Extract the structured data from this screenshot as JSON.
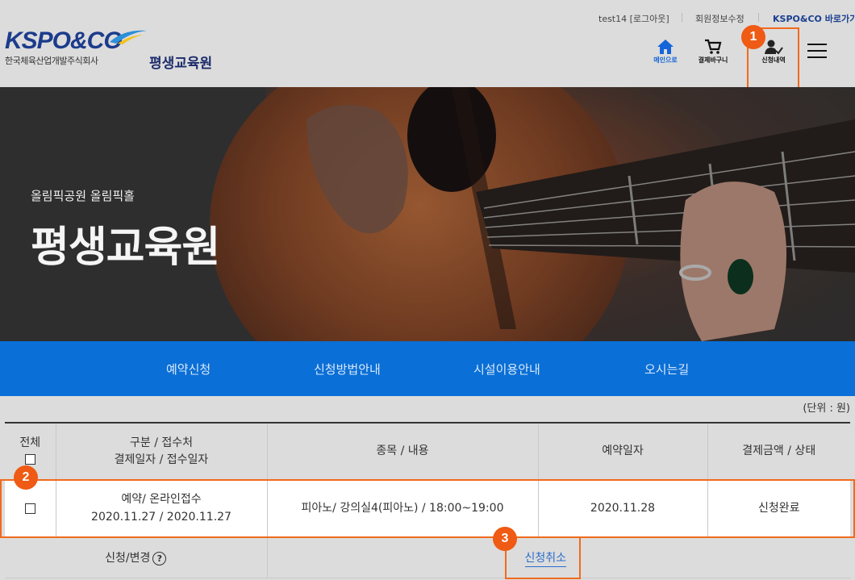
{
  "topbar": {
    "user": "test14 [로그아웃]",
    "edit_profile": "회원정보수정",
    "shortcut": "KSPO&CO 바로가기"
  },
  "logo": {
    "brand": "KSPO&CO",
    "subtitle": "한국체육산업개발주식회사"
  },
  "site_title": "평생교육원",
  "header_icons": {
    "home": "메인으로",
    "cart": "결제바구니",
    "history": "신청내역"
  },
  "badges": [
    "1",
    "2",
    "3"
  ],
  "banner": {
    "subtitle": "올림픽공원 올림픽홀",
    "title": "평생교육원"
  },
  "menu": [
    "예약신청",
    "신청방법안내",
    "시설이용안내",
    "오시는길"
  ],
  "unit_label": "(단위 : 원)",
  "table": {
    "headers": {
      "all": "전체",
      "type_line1": "구분 / 접수처",
      "type_line2": "결제일자 / 접수일자",
      "item": "종목 / 내용",
      "date": "예약일자",
      "amount": "결제금액 / 상태"
    },
    "rows": [
      {
        "type_line1": "예약/ 온라인접수",
        "type_line2": "2020.11.27 / 2020.11.27",
        "item": "피아노/ 강의실4(피아노) / 18:00~19:00",
        "date": "2020.11.28",
        "status": "신청완료"
      }
    ],
    "action_label": "신청/변경",
    "help_icon": "?",
    "cancel": "신청취소"
  },
  "colors": {
    "accent": "#f06a1d",
    "menu_bar": "#0a6fd6",
    "brand": "#1c3b8c"
  }
}
